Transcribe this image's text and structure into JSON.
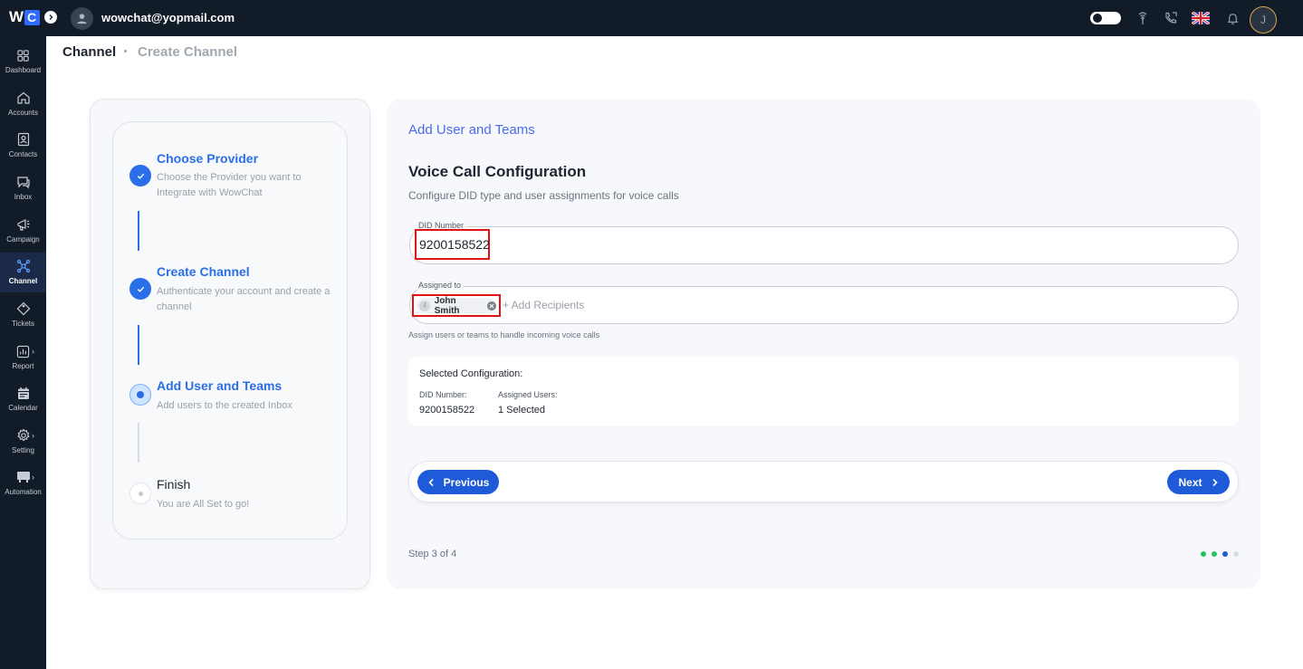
{
  "app": {
    "logo_w": "W",
    "logo_c": "C",
    "user_email": "wowchat@yopmail.com",
    "avatar_initial": "J"
  },
  "sidebar": {
    "items": [
      {
        "label": "Dashboard",
        "icon": "dashboard-icon"
      },
      {
        "label": "Accounts",
        "icon": "home-icon"
      },
      {
        "label": "Contacts",
        "icon": "contact-card-icon"
      },
      {
        "label": "Inbox",
        "icon": "chat-icon"
      },
      {
        "label": "Campaign",
        "icon": "megaphone-icon"
      },
      {
        "label": "Channel",
        "icon": "network-icon",
        "active": true
      },
      {
        "label": "Tickets",
        "icon": "ticket-icon"
      },
      {
        "label": "Report",
        "icon": "chart-icon",
        "chevron": "›"
      },
      {
        "label": "Calendar",
        "icon": "calendar-icon"
      },
      {
        "label": "Setting",
        "icon": "gear-icon",
        "chevron": "›"
      },
      {
        "label": "Automation",
        "icon": "automation-icon",
        "chevron": "›"
      }
    ]
  },
  "breadcrumb": {
    "root": "Channel",
    "current": "Create Channel"
  },
  "steps": [
    {
      "title": "Choose Provider",
      "desc": "Choose the Provider you want to Integrate with WowChat",
      "state": "done"
    },
    {
      "title": "Create Channel",
      "desc": "Authenticate your account and create a channel",
      "state": "done"
    },
    {
      "title": "Add User and Teams",
      "desc": "Add users to the created Inbox",
      "state": "current"
    },
    {
      "title": "Finish",
      "desc": "You are All Set to go!",
      "state": "pending"
    }
  ],
  "form": {
    "heading": "Add User and Teams",
    "title": "Voice Call Configuration",
    "subtitle": "Configure DID type and user assignments for voice calls",
    "did_label": "DID Number",
    "did_value": "9200158522",
    "assigned_label": "Assigned to",
    "chip_initial": "J",
    "chip_name": "John Smith",
    "add_recipients": "+ Add Recipients",
    "assign_help": "Assign users or teams to handle incoming voice calls"
  },
  "summary": {
    "title": "Selected Configuration:",
    "did_label": "DID Number:",
    "did_value": "9200158522",
    "users_label": "Assigned Users:",
    "users_value": "1 Selected"
  },
  "nav": {
    "previous": "Previous",
    "next": "Next"
  },
  "progress": {
    "text": "Step 3 of 4",
    "current": 3,
    "total": 4,
    "colors": {
      "done": "#22c55e",
      "current": "#1f5bd8",
      "pending": "#d9dde3"
    }
  }
}
